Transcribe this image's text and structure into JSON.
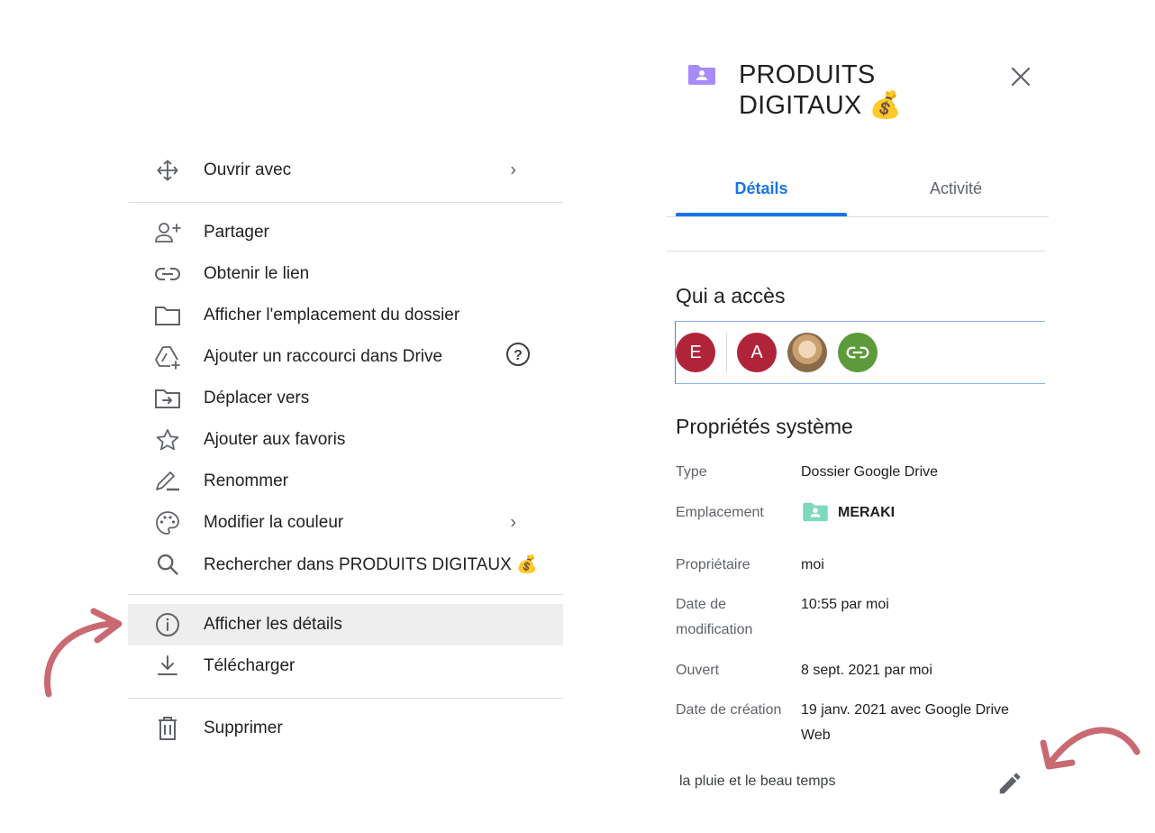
{
  "context_menu": {
    "items": [
      {
        "icon": "open-with-icon",
        "label": "Ouvrir avec",
        "submenu": true
      },
      {
        "icon": "share-person-icon",
        "label": "Partager"
      },
      {
        "icon": "link-icon",
        "label": "Obtenir le lien"
      },
      {
        "icon": "folder-icon",
        "label": "Afficher l'emplacement du dossier"
      },
      {
        "icon": "drive-shortcut-icon",
        "label": "Ajouter un raccourci dans Drive",
        "help": true
      },
      {
        "icon": "move-to-icon",
        "label": "Déplacer vers"
      },
      {
        "icon": "star-icon",
        "label": "Ajouter aux favoris"
      },
      {
        "icon": "rename-pencil-icon",
        "label": "Renommer"
      },
      {
        "icon": "palette-icon",
        "label": "Modifier la couleur",
        "submenu": true
      },
      {
        "icon": "search-icon",
        "label": "Rechercher dans PRODUITS DIGITAUX 💰"
      },
      {
        "icon": "info-icon",
        "label": "Afficher les détails",
        "highlighted": true
      },
      {
        "icon": "download-icon",
        "label": "Télécharger"
      },
      {
        "icon": "trash-icon",
        "label": "Supprimer"
      }
    ],
    "help_glyph": "?",
    "submenu_glyph": "›"
  },
  "details_panel": {
    "title": "PRODUITS DIGITAUX 💰",
    "close_glyph": "✕",
    "tabs": [
      {
        "label": "Détails",
        "active": true
      },
      {
        "label": "Activité",
        "active": false
      }
    ],
    "access": {
      "heading": "Qui a accès",
      "avatars": [
        {
          "initial": "E",
          "color": "#b0243a"
        },
        {
          "initial": "A",
          "color": "#b0243a"
        },
        {
          "initial": "",
          "kind": "photo"
        },
        {
          "initial": "",
          "kind": "link",
          "color": "#5c9a3b"
        }
      ]
    },
    "system_properties": {
      "heading": "Propriétés système",
      "type_label": "Type",
      "type_value": "Dossier Google Drive",
      "location_label": "Emplacement",
      "location_value": "MERAKI",
      "owner_label": "Propriétaire",
      "owner_value": "moi",
      "modified_label_1": "Date de",
      "modified_label_2": "modification",
      "modified_value": "10:55 par moi",
      "opened_label": "Ouvert",
      "opened_value": "8 sept. 2021 par moi",
      "created_label": "Date de création",
      "created_value_1": "19 janv. 2021 avec Google Drive",
      "created_value_2": "Web"
    },
    "description": "la pluie et le beau temps"
  },
  "colors": {
    "accent": "#1a73e8",
    "folder_purple": "#a78bfa",
    "folder_mint": "#7fd8be",
    "arrow": "#c96a73",
    "highlight_bg": "#eeeeee"
  }
}
